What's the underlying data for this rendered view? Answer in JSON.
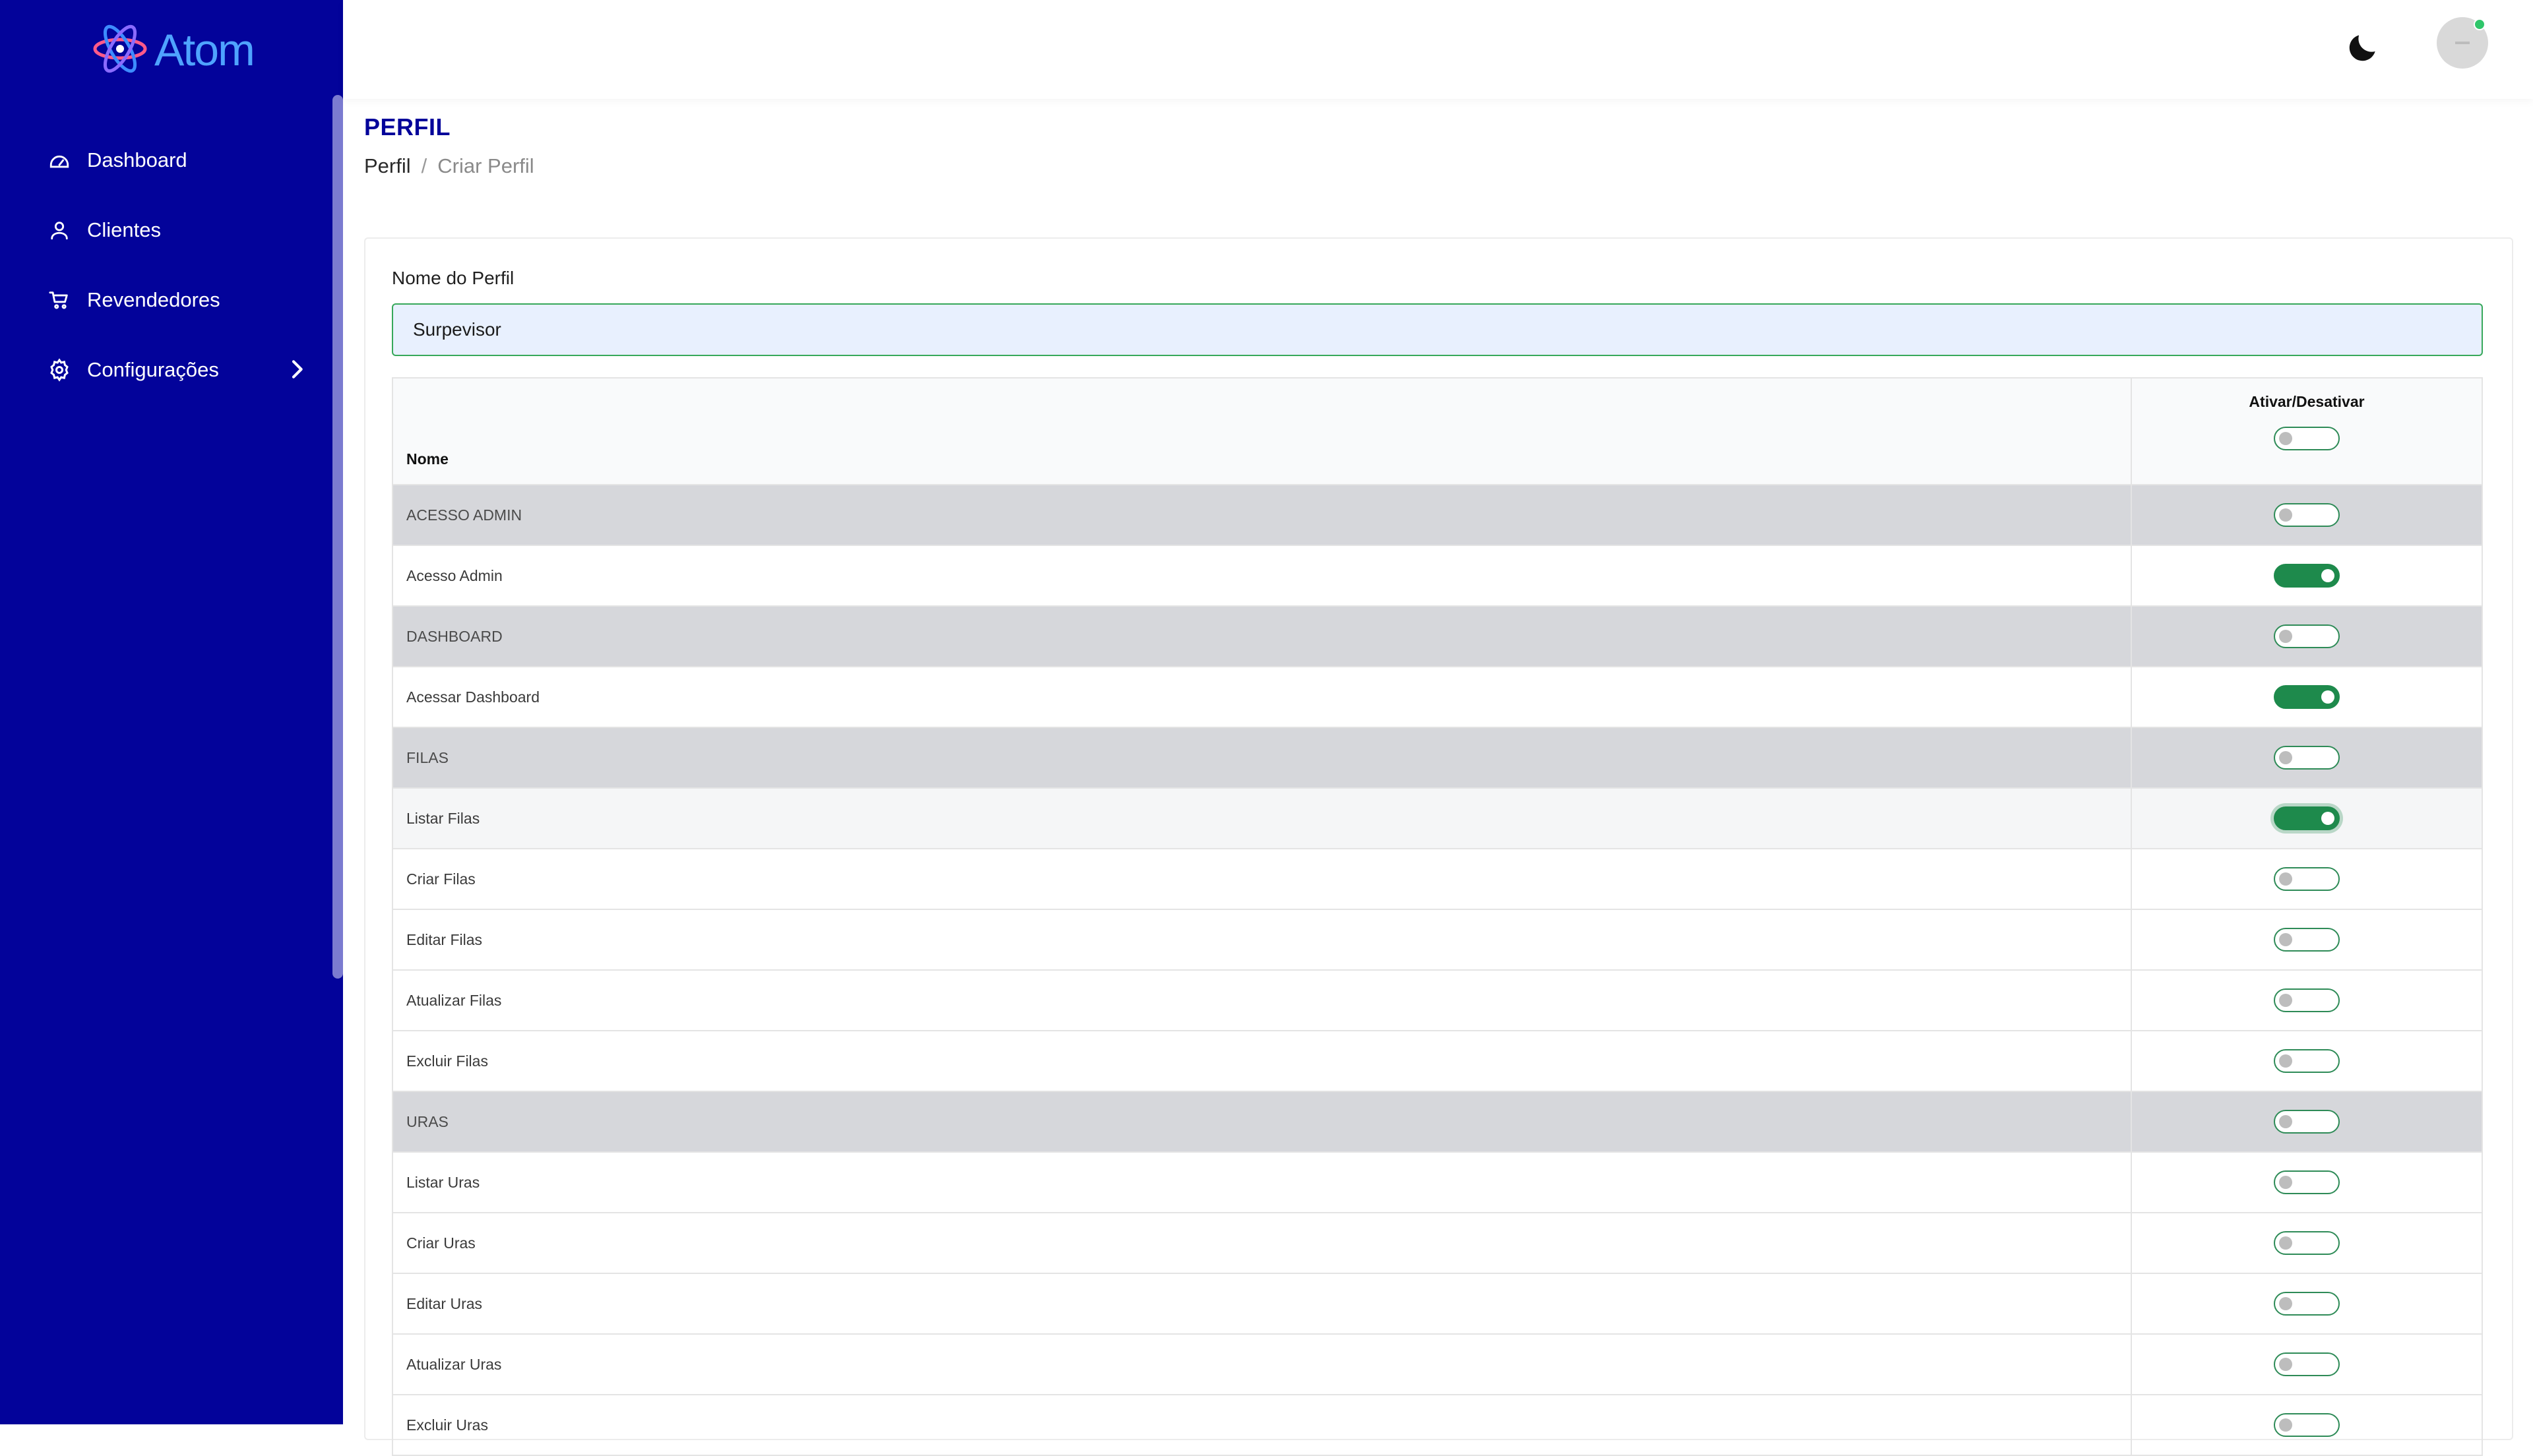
{
  "brand": {
    "name": "Atom",
    "color": "#4fa3ff"
  },
  "colors": {
    "sidebar_bg": "#03039a",
    "accent_green": "#1e8a4c",
    "title_blue": "#03039a"
  },
  "sidebar": {
    "items": [
      {
        "label": "Dashboard",
        "icon": "dashboard-gauge-icon"
      },
      {
        "label": "Clientes",
        "icon": "user-icon"
      },
      {
        "label": "Revendedores",
        "icon": "cart-icon"
      },
      {
        "label": "Configurações",
        "icon": "gear-icon",
        "has_submenu": true
      }
    ]
  },
  "topbar": {
    "theme_toggle_icon": "moon-icon",
    "avatar_status": "online"
  },
  "page": {
    "title": "PERFIL",
    "breadcrumb": [
      "Perfil",
      "Criar Perfil"
    ],
    "breadcrumb_separator": "/"
  },
  "form": {
    "profile_name_label": "Nome do Perfil",
    "profile_name_value": "Surpevisor"
  },
  "table": {
    "col_name": "Nome",
    "col_toggle": "Ativar/Desativar",
    "header_toggle_on": false,
    "rows": [
      {
        "label": "ACESSO ADMIN",
        "group": true,
        "on": false
      },
      {
        "label": "Acesso Admin",
        "group": false,
        "on": true
      },
      {
        "label": "DASHBOARD",
        "group": true,
        "on": false
      },
      {
        "label": "Acessar Dashboard",
        "group": false,
        "on": true
      },
      {
        "label": "FILAS",
        "group": true,
        "on": false
      },
      {
        "label": "Listar Filas",
        "group": false,
        "on": true,
        "focused": true
      },
      {
        "label": "Criar Filas",
        "group": false,
        "on": false
      },
      {
        "label": "Editar Filas",
        "group": false,
        "on": false
      },
      {
        "label": "Atualizar Filas",
        "group": false,
        "on": false
      },
      {
        "label": "Excluir Filas",
        "group": false,
        "on": false
      },
      {
        "label": "URAS",
        "group": true,
        "on": false
      },
      {
        "label": "Listar Uras",
        "group": false,
        "on": false
      },
      {
        "label": "Criar Uras",
        "group": false,
        "on": false
      },
      {
        "label": "Editar Uras",
        "group": false,
        "on": false
      },
      {
        "label": "Atualizar Uras",
        "group": false,
        "on": false
      },
      {
        "label": "Excluir Uras",
        "group": false,
        "on": false
      }
    ]
  }
}
